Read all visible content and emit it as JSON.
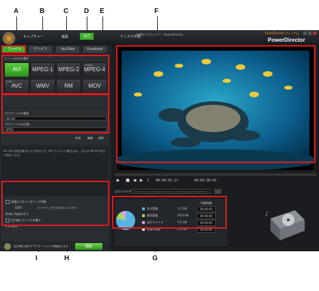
{
  "callouts": {
    "A": "A",
    "B": "B",
    "C": "C",
    "D": "D",
    "E": "E",
    "F": "F",
    "G": "G",
    "H": "H",
    "I": "I"
  },
  "app": {
    "title": "PowerDirector",
    "window_title": "無題のプロジェクト - PowerDirector",
    "top_nav": {
      "capture": "キャプチャー",
      "edit": "編集",
      "produce": "出力",
      "disc": "ディスク作成"
    },
    "top_right_link": "PowerDirector プレミアム"
  },
  "tabs": [
    "ファイル",
    "デバイス",
    "YouTube",
    "Facebook"
  ],
  "formats": {
    "label": "ファイル形式の選択",
    "items": [
      {
        "label": "AVI",
        "selected": true
      },
      {
        "label": "MPEG-1",
        "selected": false
      },
      {
        "label": "MPEG-2",
        "selected": false
      },
      {
        "label": "MPEG-4",
        "selected": false,
        "note": "Portable"
      },
      {
        "label": "AVC",
        "selected": false,
        "note": "H.264"
      },
      {
        "label": "WMV",
        "selected": false
      },
      {
        "label": "RM",
        "selected": false
      },
      {
        "label": "MOV",
        "selected": false
      }
    ]
  },
  "settings": {
    "label1": "プロファイルの種類",
    "value1": "DV-AVI",
    "label2": "プロファイル名/品質",
    "value2": "NTSC",
    "buttons": [
      "作成",
      "編集",
      "削除"
    ]
  },
  "description": "DV AVI は高品質のビデオ形式です。DV カメラへの書き込み、または DV-AVI 形式で保存します。",
  "options": {
    "items": [
      "高速ビデオレンダリング技術",
      "SVRT",
      "ハードウェアビデオエンコーダー",
      "Dolby Digital 5.1",
      "出力後にファイルを開く",
      "x.v.Color"
    ],
    "status_text": "出力時に他のアプリケーションを無効にする",
    "start_label": "開始"
  },
  "player": {
    "timecode_current": "00:00:01:27",
    "timecode_total": "00:03:30:01"
  },
  "output": {
    "label": "出力フォルダー:",
    "path": "C:\\Documents and Settings\\user\\My Documents\\CyberLink\\PowerDirector",
    "browse": "..."
  },
  "stats": {
    "header": "所要時間",
    "legend": [
      {
        "label": "空き容量",
        "value": "2.1 GB",
        "color": "#57b5e6"
      },
      {
        "label": "使用容量",
        "value": "20.0 GB",
        "color": "#a9d36a"
      },
      {
        "label": "出力ファイル",
        "value": "0.2 GB",
        "color": "#d8a3e8"
      },
      {
        "label": "必要な容量",
        "value": "0.2 GB",
        "color": "#e8e8e8"
      }
    ],
    "times": [
      "00:00:00",
      "00:00:00",
      "00:00:00",
      "00:00:00"
    ]
  }
}
